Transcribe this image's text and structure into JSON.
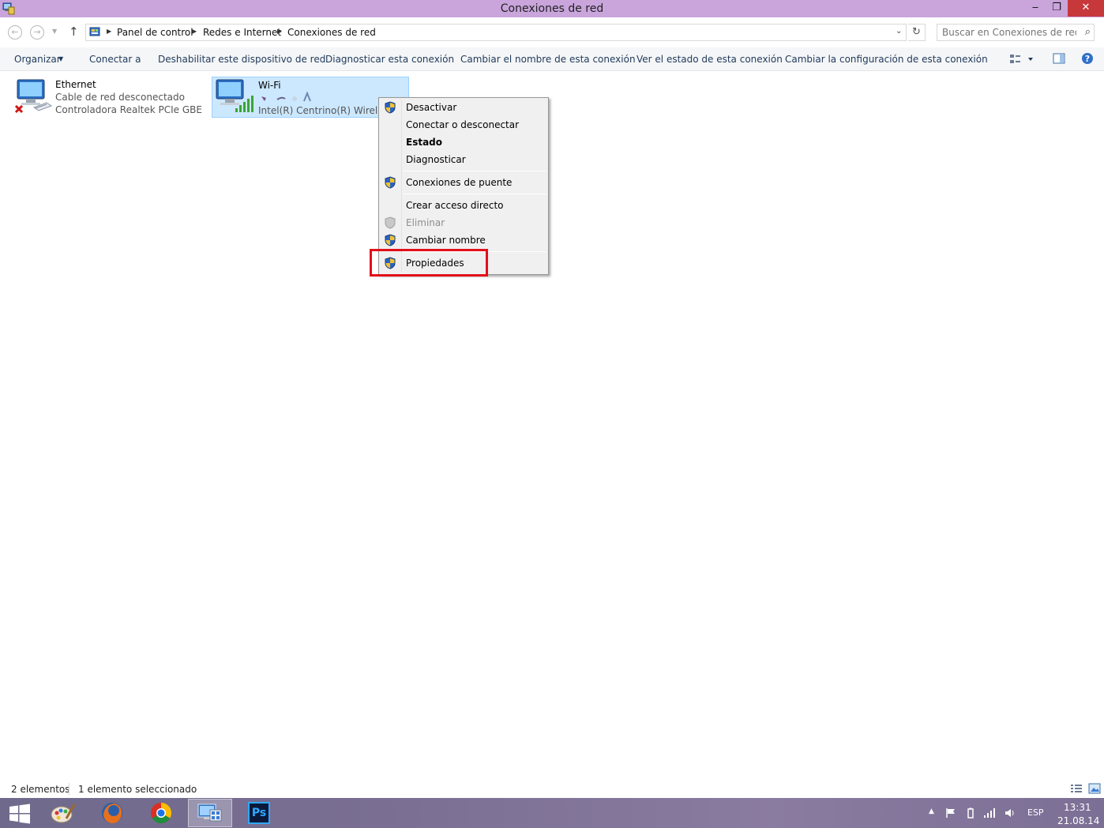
{
  "window": {
    "title": "Conexiones de red",
    "minimize": "‒",
    "maximize": "❐",
    "close": "✕"
  },
  "address": {
    "crumbs": [
      "Panel de control",
      "Redes e Internet",
      "Conexiones de red"
    ],
    "search_placeholder": "Buscar en Conexiones de red"
  },
  "commands": {
    "organize": "Organizar",
    "connect_to": "Conectar a",
    "disable_device": "Deshabilitar este dispositivo de red",
    "diagnose": "Diagnosticar esta conexión",
    "rename": "Cambiar el nombre de esta conexión",
    "view_status": "Ver el estado de esta conexión",
    "change_settings": "Cambiar la configuración de esta conexión"
  },
  "connections": [
    {
      "name": "Ethernet",
      "status": "Cable de red desconectado",
      "device": "Controladora Realtek PCIe GBE Fa..."
    },
    {
      "name": "Wi-Fi",
      "status": "",
      "device": "Intel(R) Centrino(R) Wireless-"
    }
  ],
  "context_menu": {
    "items": [
      {
        "label": "Desactivar",
        "shield": true,
        "bold": false,
        "disabled": false
      },
      {
        "label": "Conectar o desconectar",
        "shield": false,
        "bold": false,
        "disabled": false
      },
      {
        "label": "Estado",
        "shield": false,
        "bold": true,
        "disabled": false
      },
      {
        "label": "Diagnosticar",
        "shield": false,
        "bold": false,
        "disabled": false
      },
      {
        "label": "Conexiones de puente",
        "shield": true,
        "bold": false,
        "disabled": false
      },
      {
        "label": "Crear acceso directo",
        "shield": false,
        "bold": false,
        "disabled": false
      },
      {
        "label": "Eliminar",
        "shield": true,
        "bold": false,
        "disabled": true
      },
      {
        "label": "Cambiar nombre",
        "shield": true,
        "bold": false,
        "disabled": false
      },
      {
        "label": "Propiedades",
        "shield": true,
        "bold": false,
        "disabled": false
      }
    ],
    "highlighted": "Propiedades"
  },
  "statusbar": {
    "count": "2 elementos",
    "selected": "1 elemento seleccionado"
  },
  "taskbar": {
    "apps": [
      "start-icon",
      "paint-icon",
      "firefox-icon",
      "chrome-icon",
      "network-connections-icon",
      "photoshop-icon"
    ],
    "photoshop_label": "Ps",
    "language": "ESP",
    "time": "13:31",
    "date": "21.08.14"
  },
  "colors": {
    "titlebar": "#c9a5dc",
    "close": "#c7383b",
    "selection": "#cce8ff",
    "highlight_box": "#e2101a",
    "link_text": "#1e395b"
  }
}
